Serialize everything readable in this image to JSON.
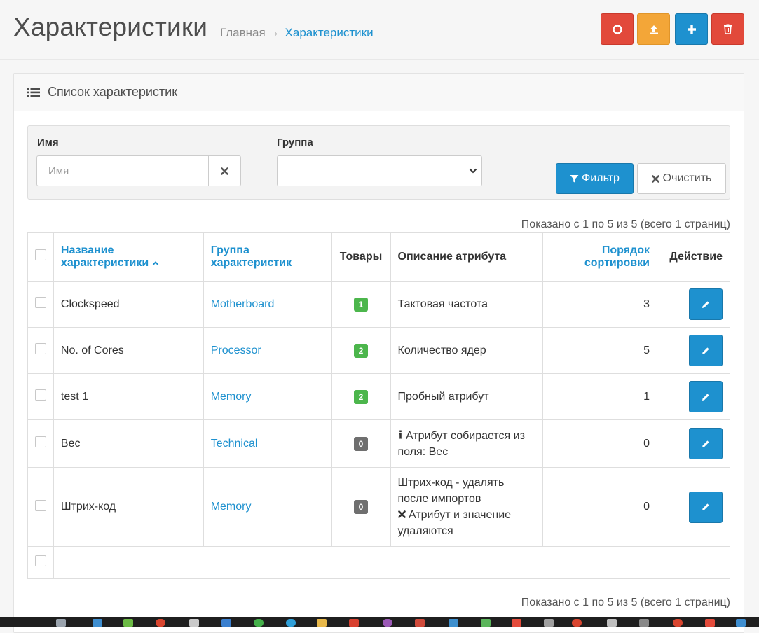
{
  "header": {
    "title": "Характеристики",
    "breadcrumb": {
      "home": "Главная",
      "separator": "›",
      "current": "Характеристики"
    },
    "buttons": [
      {
        "icon": "circle-icon",
        "color": "#e2493b"
      },
      {
        "icon": "upload-icon",
        "color": "#f3a638"
      },
      {
        "icon": "plus-icon",
        "color": "#1e91cf"
      },
      {
        "icon": "trash-icon",
        "color": "#e2493b"
      }
    ]
  },
  "panel": {
    "title": "Список характеристик",
    "icon": "list-icon"
  },
  "filter": {
    "name_label": "Имя",
    "name_placeholder": "Имя",
    "name_value": "",
    "group_label": "Группа",
    "group_value": "",
    "filter_button": "Фильтр",
    "clear_button": "Очистить"
  },
  "pagination_text": "Показано с 1 по 5 из 5 (всего 1 страниц)",
  "table": {
    "columns": {
      "name": "Название характеристики",
      "group": "Группа характеристик",
      "products": "Товары",
      "description": "Описание атрибута",
      "sort_order": "Порядок сортировки",
      "action": "Действие"
    },
    "rows": [
      {
        "name": "Clockspeed",
        "group": "Motherboard",
        "products": "1",
        "description": [
          "Тактовая частота"
        ],
        "sort_order": "3"
      },
      {
        "name": "No. of Cores",
        "group": "Processor",
        "products": "2",
        "description": [
          "Количество ядер"
        ],
        "sort_order": "5"
      },
      {
        "name": "test 1",
        "group": "Memory",
        "products": "2",
        "description": [
          "Пробный атрибут"
        ],
        "sort_order": "1"
      },
      {
        "name": "Вес",
        "group": "Technical",
        "products": "0",
        "description": [
          "Атрибут собирается из поля: Вес"
        ],
        "sort_order": "0"
      },
      {
        "name": "Штрих-код",
        "group": "Memory",
        "products": "0",
        "description": [
          "Штрих-код - удалять после импортов",
          "Атрибут и значение удаляются"
        ],
        "sort_order": "0"
      }
    ]
  },
  "colors": {
    "primary": "#1e91cf",
    "danger": "#e2493b",
    "warning": "#f3a638",
    "success": "#4cb64c",
    "default_badge": "#6f6f6f"
  }
}
